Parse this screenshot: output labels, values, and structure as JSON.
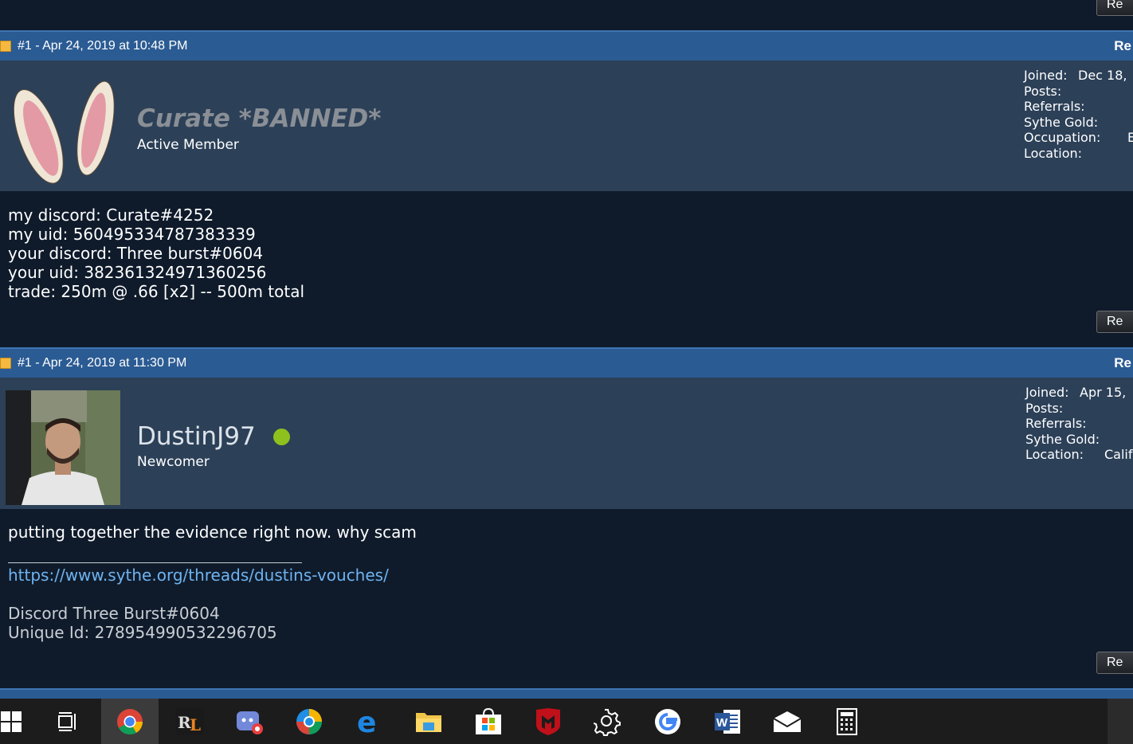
{
  "top_reply_label": "Re",
  "posts": [
    {
      "header_date": "#1 - Apr 24, 2019 at 10:48 PM",
      "header_reply": "Re",
      "username": "Curate *BANNED*",
      "user_title": "Active Member",
      "stats": [
        {
          "label": "Joined:",
          "value": "Dec 18,"
        },
        {
          "label": "Posts:",
          "value": ""
        },
        {
          "label": "Referrals:",
          "value": ""
        },
        {
          "label": "Sythe Gold:",
          "value": ""
        },
        {
          "label": "Occupation:",
          "value": "E"
        },
        {
          "label": "Location:",
          "value": ""
        }
      ],
      "body_lines": [
        "my discord: Curate#4252",
        "my uid: 560495334787383339",
        "your discord: Three burst#0604",
        "your uid: 382361324971360256",
        "trade: 250m @ .66 [x2] -- 500m total"
      ],
      "reply_label": "Re"
    },
    {
      "header_date": "#1 - Apr 24, 2019 at 11:30 PM",
      "header_reply": "Re",
      "username": "DustinJ97",
      "user_title": "Newcomer",
      "online_color": "#8fc11e",
      "stats": [
        {
          "label": "Joined:",
          "value": "Apr 15,"
        },
        {
          "label": "Posts:",
          "value": ""
        },
        {
          "label": "Referrals:",
          "value": ""
        },
        {
          "label": "Sythe Gold:",
          "value": ""
        },
        {
          "label": "Location:",
          "value": "Calif"
        }
      ],
      "body_text": "putting together the evidence right now. why scam",
      "signature_link": "https://www.sythe.org/threads/dustins-vouches/",
      "signature_lines": [
        "Discord Three Burst#0604",
        "Unique Id: 278954990532296705"
      ],
      "reply_label": "Re"
    }
  ],
  "taskbar": {
    "items": [
      {
        "name": "start-button",
        "icon": "windows-logo-icon"
      },
      {
        "name": "task-view-button",
        "icon": "task-view-icon"
      },
      {
        "name": "chrome-button",
        "icon": "chrome-icon",
        "active": true
      },
      {
        "name": "runelite-button",
        "icon": "runelite-icon"
      },
      {
        "name": "discord-button",
        "icon": "discord-icon"
      },
      {
        "name": "chromium-button",
        "icon": "chromium-icon"
      },
      {
        "name": "edge-button",
        "icon": "edge-icon"
      },
      {
        "name": "file-explorer-button",
        "icon": "folder-icon"
      },
      {
        "name": "store-button",
        "icon": "store-icon"
      },
      {
        "name": "mcafee-button",
        "icon": "mcafee-icon"
      },
      {
        "name": "settings-button",
        "icon": "gear-icon"
      },
      {
        "name": "google-button",
        "icon": "google-icon"
      },
      {
        "name": "word-button",
        "icon": "word-icon"
      },
      {
        "name": "mail-button",
        "icon": "mail-icon"
      },
      {
        "name": "calculator-button",
        "icon": "calculator-icon"
      }
    ]
  },
  "colors": {
    "background": "#0f1b2b",
    "header_bar": "#2b5b93",
    "user_panel": "#2c4058",
    "link": "#6fb3f0",
    "banned_name": "#8a8f96"
  }
}
